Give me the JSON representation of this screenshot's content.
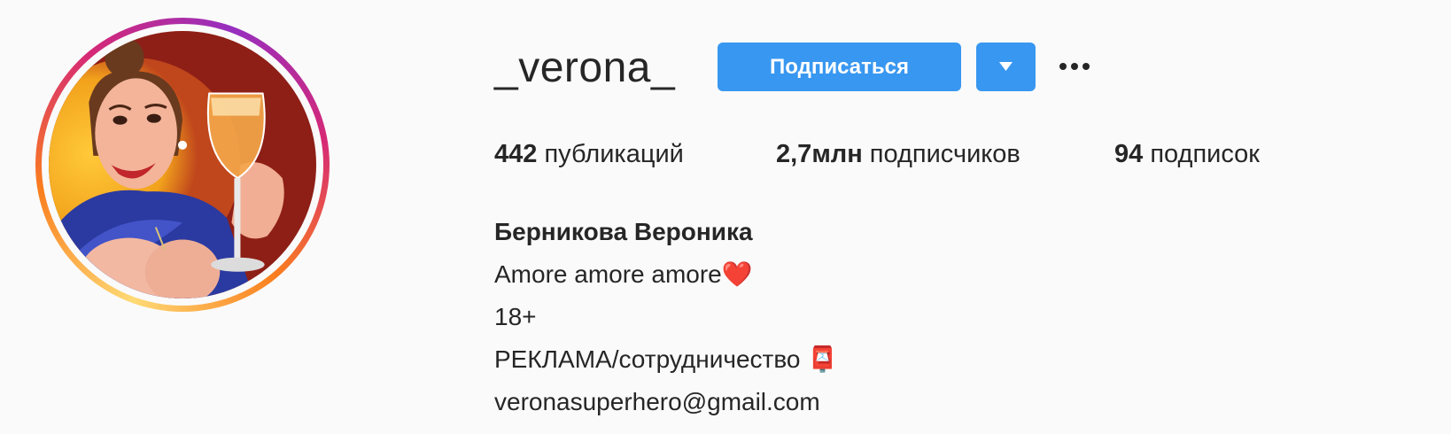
{
  "profile": {
    "username": "_verona_",
    "follow_label": "Подписаться",
    "stats": {
      "posts_count": "442",
      "posts_label": "публикаций",
      "followers_count": "2,7млн",
      "followers_label": "подписчиков",
      "following_count": "94",
      "following_label": "подписок"
    },
    "bio": {
      "full_name": "Берникова Вероника",
      "line1": "Amore amore amore❤️",
      "line2": "18+",
      "line3": "РЕКЛАМА/сотрудничество 📮",
      "email": "veronasuperhero@gmail.com"
    }
  },
  "icons": {
    "dropdown": "chevron-down-icon",
    "more": "more-options-icon",
    "avatar": "profile-picture"
  },
  "colors": {
    "accent": "#3897f0",
    "text": "#262626",
    "background": "#fafafa"
  }
}
